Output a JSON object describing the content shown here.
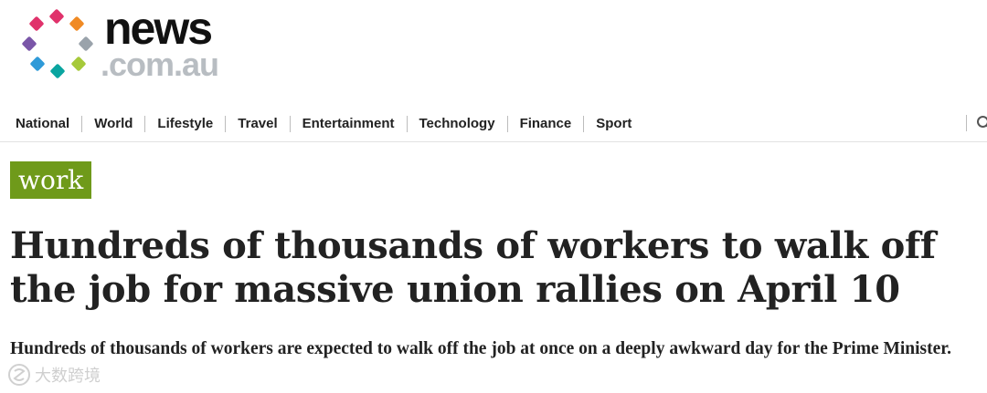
{
  "logo": {
    "word_main": "news",
    "word_sub": ".com.au",
    "dot_colors": [
      "#e0326b",
      "#f08a24",
      "#9aa3ab",
      "#a6c93a",
      "#0aa5a0",
      "#2f9ad8",
      "#7a56a8",
      "#e0326b"
    ]
  },
  "nav": {
    "items": [
      {
        "label": "National"
      },
      {
        "label": "World"
      },
      {
        "label": "Lifestyle"
      },
      {
        "label": "Travel"
      },
      {
        "label": "Entertainment"
      },
      {
        "label": "Technology"
      },
      {
        "label": "Finance"
      },
      {
        "label": "Sport"
      }
    ],
    "search_icon": "search-icon"
  },
  "article": {
    "tag": "work",
    "tag_color": "#6f9a1a",
    "headline": "Hundreds of thousands of workers to walk off the job for massive union rallies on April 10",
    "standfirst": "Hundreds of thousands of workers are expected to walk off the job at once on a deeply awkward day for the Prime Minister."
  },
  "watermark": {
    "text": "大数跨境"
  }
}
